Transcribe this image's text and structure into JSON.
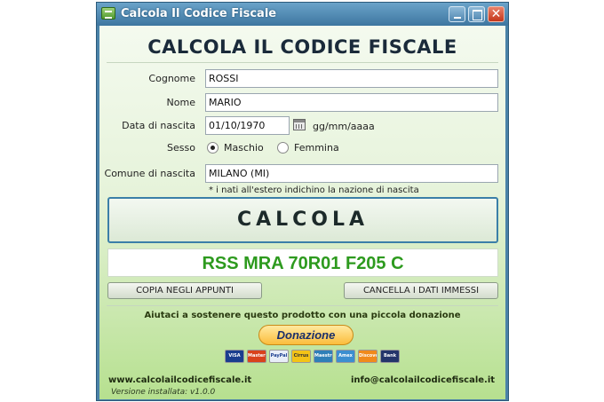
{
  "window": {
    "title": "Calcola Il Codice Fiscale",
    "buttons": [
      "minimize",
      "maximize",
      "close"
    ]
  },
  "heading": "CALCOLA IL CODICE FISCALE",
  "form": {
    "cognome": {
      "label": "Cognome",
      "value": "ROSSI"
    },
    "nome": {
      "label": "Nome",
      "value": "MARIO"
    },
    "data_nascita": {
      "label": "Data di nascita",
      "value": "01/10/1970",
      "format_hint": "gg/mm/aaaa"
    },
    "sesso": {
      "label": "Sesso",
      "options": [
        {
          "label": "Maschio",
          "checked": true
        },
        {
          "label": "Femmina",
          "checked": false
        }
      ]
    },
    "comune": {
      "label": "Comune di nascita",
      "value": "MILANO (MI)"
    },
    "note": "* i nati all'estero indichino la nazione di nascita"
  },
  "calcola_label": "CALCOLA",
  "result": "RSS MRA 70R01 F205 C",
  "actions": {
    "copy_label": "COPIA NEGLI APPUNTI",
    "clear_label": "CANCELLA I DATI IMMESSI"
  },
  "donation": {
    "text": "Aiutaci a sostenere questo prodotto con una piccola donazione",
    "button_label": "Donazione",
    "cards": [
      "VISA",
      "MasterCard",
      "PayPal",
      "Cirrus",
      "Maestro",
      "Amex",
      "Discover",
      "Bank"
    ]
  },
  "footer": {
    "website": "www.calcolailcodicefiscale.it",
    "email": "info@calcolailcodicefiscale.it",
    "version": "Versione installata: v1.0.0"
  },
  "colors": {
    "titlebar": "#4a82a8",
    "result_text": "#2d9a1e",
    "accent_border": "#3b7fa8"
  }
}
